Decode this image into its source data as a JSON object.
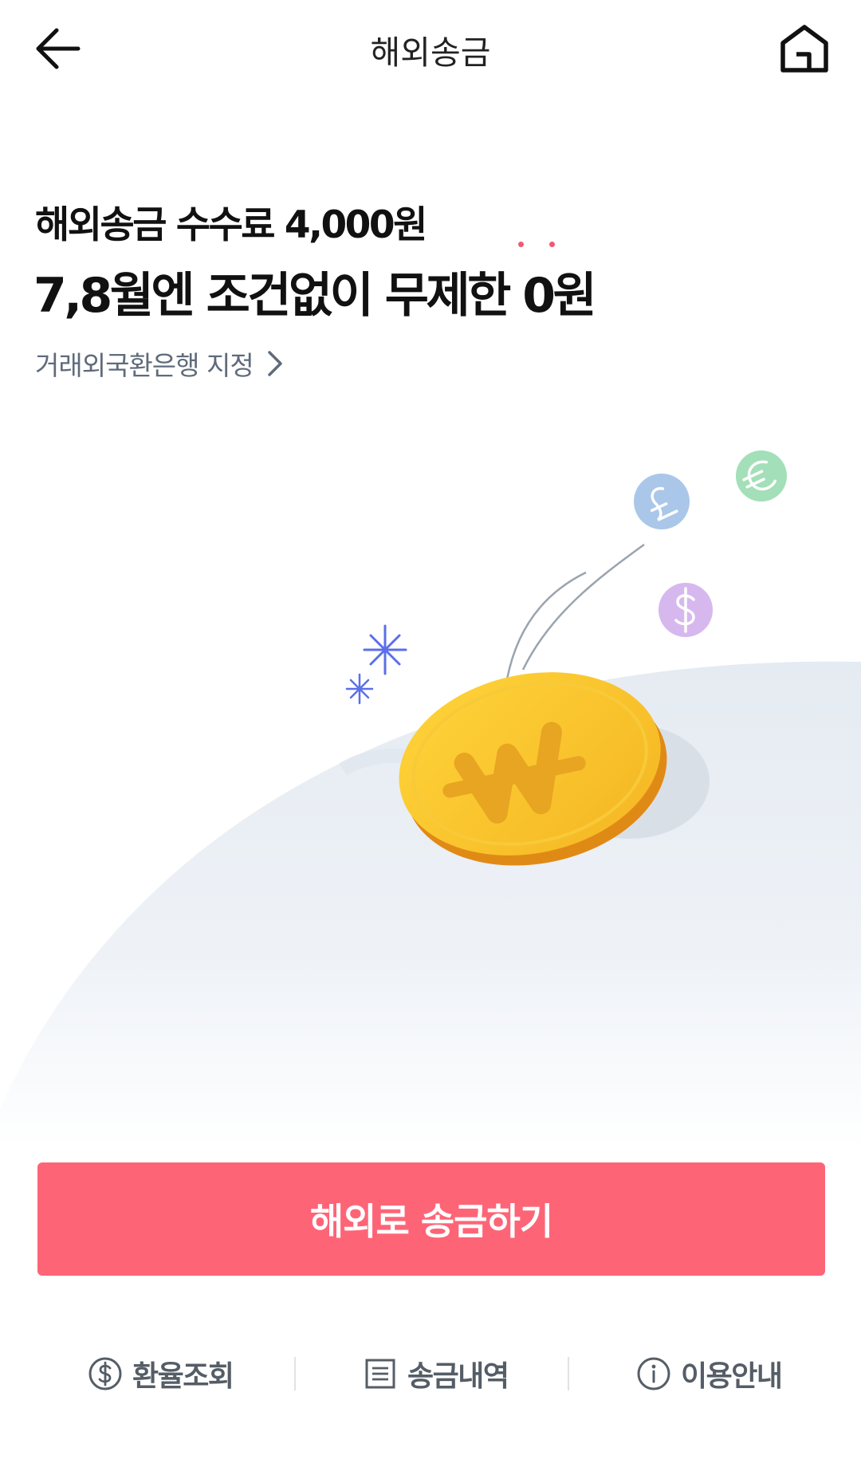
{
  "header": {
    "title": "해외송금",
    "back_icon": "arrow-left-icon",
    "home_icon": "home-icon"
  },
  "promo": {
    "line1": "해외송금 수수료 4,000원",
    "line2": "7,8월엔 조건없이 무제한 0원",
    "emphasis_color": "#ef5a72"
  },
  "bank_link": {
    "label": "거래외국환은행 지정",
    "icon": "chevron-right-icon"
  },
  "illustration": {
    "coin_icon": "won-coin-icon",
    "currency_icons": [
      "pound-coin-icon",
      "euro-coin-icon",
      "dollar-coin-icon"
    ]
  },
  "cta": {
    "label": "해외로 송금하기",
    "color": "#fd6577"
  },
  "bottom_nav": [
    {
      "label": "환율조회",
      "icon": "dollar-circle-icon"
    },
    {
      "label": "송금내역",
      "icon": "list-document-icon"
    },
    {
      "label": "이용안내",
      "icon": "info-circle-icon"
    }
  ]
}
